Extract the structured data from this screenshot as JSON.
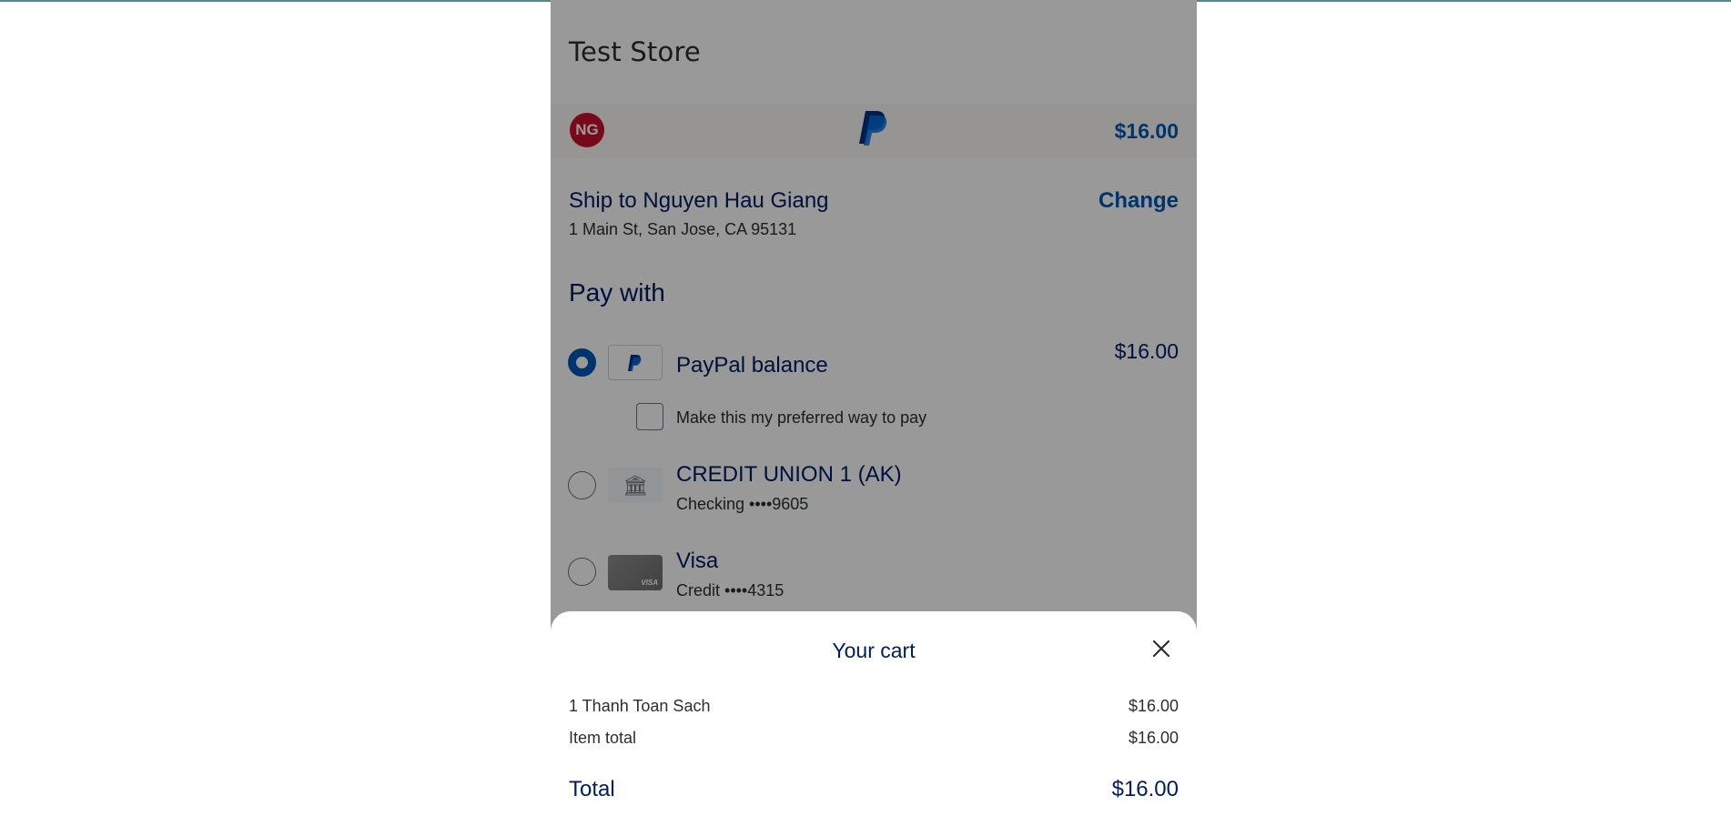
{
  "store": {
    "name": "Test Store"
  },
  "account_bar": {
    "avatar_initials": "NG",
    "paypal_logo": "paypal-logo",
    "amount": "$16.00"
  },
  "shipping": {
    "title": "Ship to Nguyen Hau Giang",
    "address": "1 Main St, San Jose, CA 95131",
    "change_label": "Change"
  },
  "pay_with": {
    "heading": "Pay with",
    "methods": [
      {
        "name": "PayPal balance",
        "amount": "$16.00",
        "icon": "paypal-icon",
        "selected": true
      },
      {
        "name": "CREDIT UNION 1 (AK)",
        "sub": "Checking ••••9605",
        "icon": "bank-icon",
        "selected": false
      },
      {
        "name": "Visa",
        "sub": "Credit ••••4315",
        "icon": "visa-card-icon",
        "selected": false
      }
    ],
    "preferred_label": "Make this my preferred way to pay"
  },
  "cart": {
    "title": "Your cart",
    "close_icon": "close-icon",
    "items": [
      {
        "label": "1 Thanh Toan Sach",
        "value": "$16.00"
      },
      {
        "label": "Item total",
        "value": "$16.00"
      }
    ],
    "total_label": "Total",
    "total_value": "$16.00"
  },
  "colors": {
    "accent": "#0057b8",
    "text_dark": "#001c64",
    "avatar_bg": "#c8102e",
    "overlay": "rgba(0,0,0,0.40)"
  }
}
